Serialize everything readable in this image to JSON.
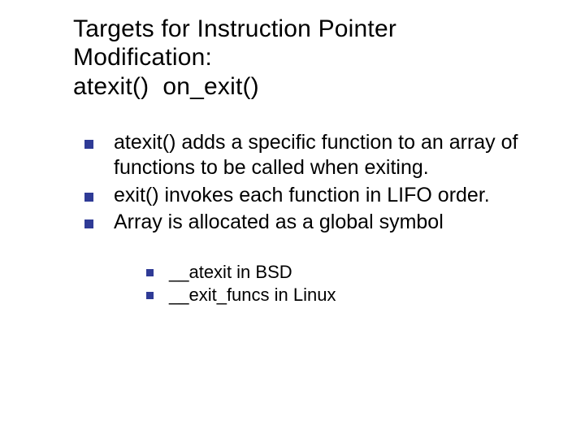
{
  "title": {
    "line1": "Targets for Instruction Pointer",
    "line2": "Modification:",
    "line3": "atexit()  on_exit()"
  },
  "bullets": [
    "atexit() adds a specific function to an array of functions to be called when exiting.",
    "exit() invokes each function in LIFO order.",
    "Array is allocated as a global symbol"
  ],
  "sub_bullets": [
    "__atexit in BSD",
    "__exit_funcs in Linux"
  ]
}
